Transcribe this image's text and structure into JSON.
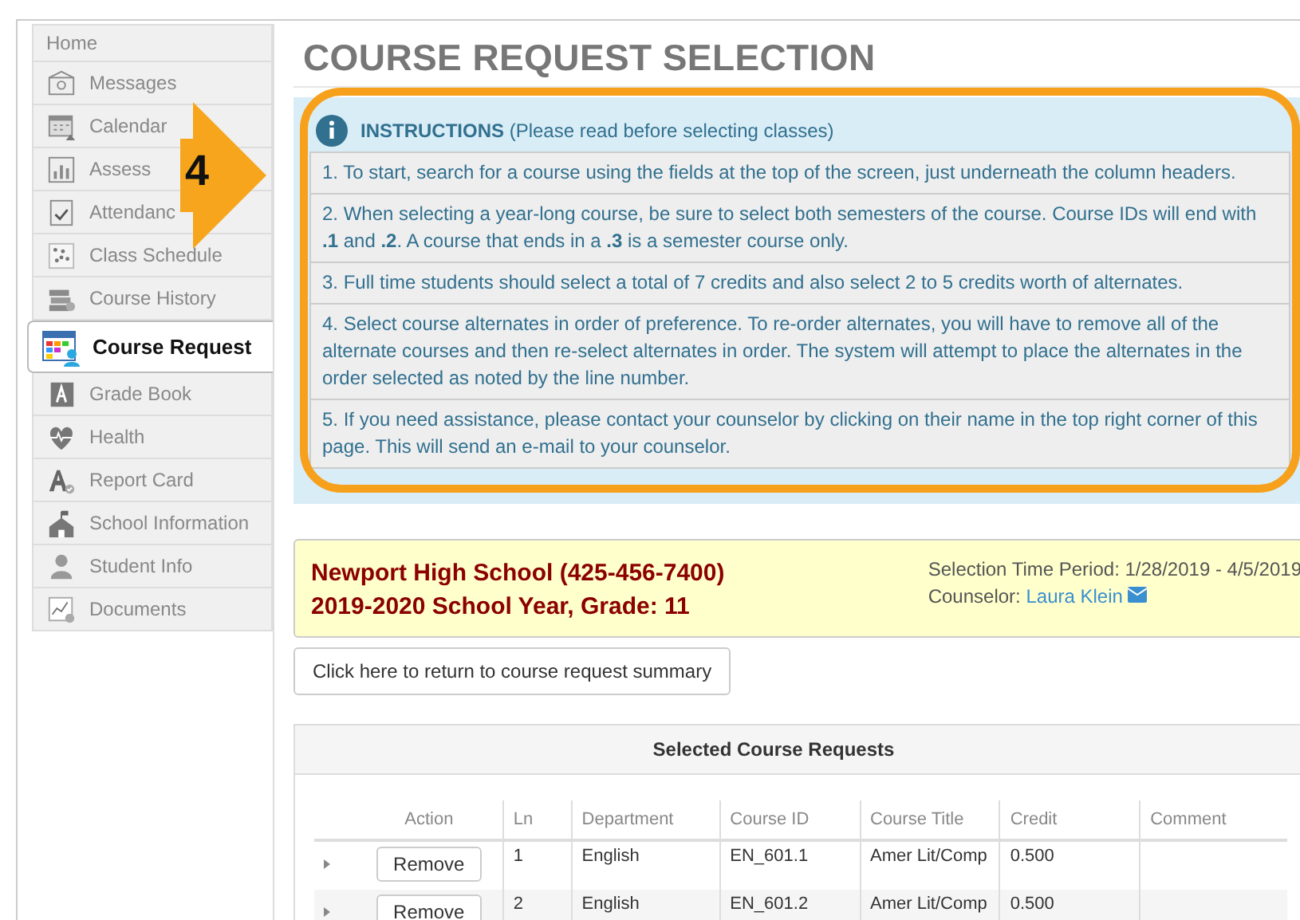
{
  "sidebar": {
    "items": [
      {
        "label": "Home",
        "selected": false
      },
      {
        "label": "Messages",
        "selected": false
      },
      {
        "label": "Calendar",
        "selected": false
      },
      {
        "label": "Assess",
        "selected": false
      },
      {
        "label": "Attendanc",
        "selected": false
      },
      {
        "label": "Class Schedule",
        "selected": false
      },
      {
        "label": "Course History",
        "selected": false
      },
      {
        "label": "Course Request",
        "selected": true
      },
      {
        "label": "Grade Book",
        "selected": false
      },
      {
        "label": "Health",
        "selected": false
      },
      {
        "label": "Report Card",
        "selected": false
      },
      {
        "label": "School Information",
        "selected": false
      },
      {
        "label": "Student Info",
        "selected": false
      },
      {
        "label": "Documents",
        "selected": false
      }
    ]
  },
  "callout": {
    "label": "4"
  },
  "page_title": "COURSE REQUEST SELECTION",
  "instructions": {
    "header": "**INSTRUCTIONS** (Please read before selecting classes)",
    "items": [
      "1. To start, search for a course using the fields at the top of the screen, just underneath the column headers.",
      "2. When selecting a year-long course, be sure to select both semesters of the course. Course IDs will end with **.1** and **.2**. A course that ends in a **.3** is a semester course only.",
      "3. Full time students should select a total of 7 credits and also select 2 to 5 credits worth of alternates.",
      "4. Select course alternates in order of preference. To re-order alternates, you will have to remove all of the alternate courses and then re-select alternates in order. The system will attempt to place the alternates in the order selected as noted by the line number.",
      "5. If you need assistance, please contact your counselor by clicking on their name in the top right corner of this page. This will send an e-mail to your counselor."
    ]
  },
  "school": {
    "name": "Newport High School (425-456-7400)",
    "year": "2019-2020 School Year, Grade: 11",
    "period": "Selection Time Period: 1/28/2019 - 4/5/2019",
    "counselor_label": "Counselor:",
    "counselor": "Laura Klein"
  },
  "summary_button": "Click here to return to course request summary",
  "table": {
    "title": "Selected Course Requests",
    "columns": [
      "Action",
      "Ln",
      "Department",
      "Course ID",
      "Course Title",
      "Credit",
      "Comment"
    ],
    "rows": [
      {
        "button": "Remove",
        "ln": "1",
        "department": "English",
        "course_id": "EN_601.1",
        "course_title": "Amer Lit/Comp",
        "credit": "0.500"
      },
      {
        "button": "Remove",
        "ln": "2",
        "department": "English",
        "course_id": "EN_601.2",
        "course_title": "Amer Lit/Comp",
        "credit": "0.500"
      }
    ]
  }
}
